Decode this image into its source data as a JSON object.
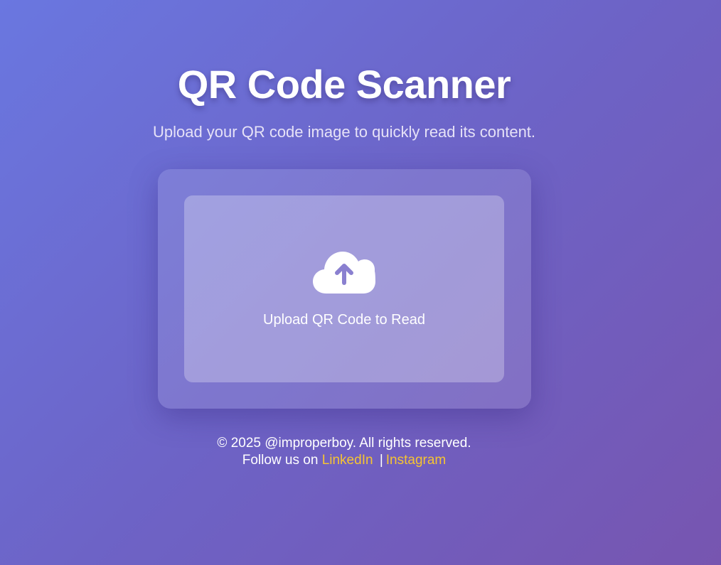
{
  "header": {
    "title": "QR Code Scanner",
    "subtitle": "Upload your QR code image to quickly read its content."
  },
  "upload": {
    "icon": "cloud-upload-icon",
    "label": "Upload QR Code to Read"
  },
  "footer": {
    "copyright": "© 2025 @improperboy. All rights reserved.",
    "follow_prefix": "Follow us on",
    "separator": "|",
    "links": [
      {
        "label": "LinkedIn"
      },
      {
        "label": "Instagram"
      }
    ]
  },
  "colors": {
    "gradient_start": "#6a77e0",
    "gradient_end": "#7755b0",
    "link": "#f6c432",
    "icon_arrow": "#8a80d0"
  }
}
